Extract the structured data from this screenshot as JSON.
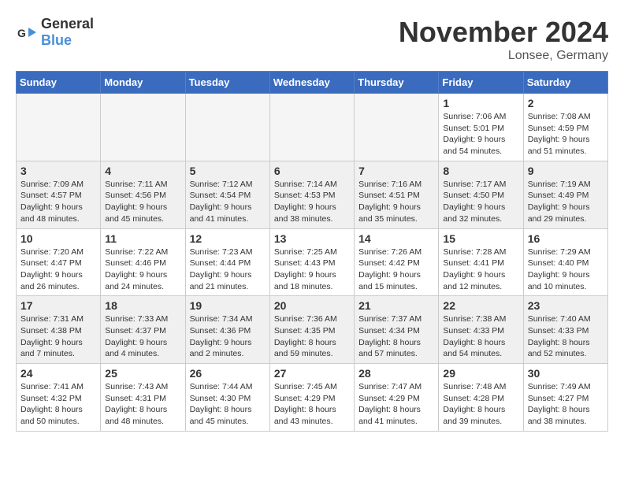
{
  "logo": {
    "text_general": "General",
    "text_blue": "Blue"
  },
  "header": {
    "month": "November 2024",
    "location": "Lonsee, Germany"
  },
  "weekdays": [
    "Sunday",
    "Monday",
    "Tuesday",
    "Wednesday",
    "Thursday",
    "Friday",
    "Saturday"
  ],
  "weeks": [
    [
      {
        "day": "",
        "empty": true
      },
      {
        "day": "",
        "empty": true
      },
      {
        "day": "",
        "empty": true
      },
      {
        "day": "",
        "empty": true
      },
      {
        "day": "",
        "empty": true
      },
      {
        "day": "1",
        "sunrise": "7:06 AM",
        "sunset": "5:01 PM",
        "daylight": "9 hours and 54 minutes."
      },
      {
        "day": "2",
        "sunrise": "7:08 AM",
        "sunset": "4:59 PM",
        "daylight": "9 hours and 51 minutes."
      }
    ],
    [
      {
        "day": "3",
        "sunrise": "7:09 AM",
        "sunset": "4:57 PM",
        "daylight": "9 hours and 48 minutes."
      },
      {
        "day": "4",
        "sunrise": "7:11 AM",
        "sunset": "4:56 PM",
        "daylight": "9 hours and 45 minutes."
      },
      {
        "day": "5",
        "sunrise": "7:12 AM",
        "sunset": "4:54 PM",
        "daylight": "9 hours and 41 minutes."
      },
      {
        "day": "6",
        "sunrise": "7:14 AM",
        "sunset": "4:53 PM",
        "daylight": "9 hours and 38 minutes."
      },
      {
        "day": "7",
        "sunrise": "7:16 AM",
        "sunset": "4:51 PM",
        "daylight": "9 hours and 35 minutes."
      },
      {
        "day": "8",
        "sunrise": "7:17 AM",
        "sunset": "4:50 PM",
        "daylight": "9 hours and 32 minutes."
      },
      {
        "day": "9",
        "sunrise": "7:19 AM",
        "sunset": "4:49 PM",
        "daylight": "9 hours and 29 minutes."
      }
    ],
    [
      {
        "day": "10",
        "sunrise": "7:20 AM",
        "sunset": "4:47 PM",
        "daylight": "9 hours and 26 minutes."
      },
      {
        "day": "11",
        "sunrise": "7:22 AM",
        "sunset": "4:46 PM",
        "daylight": "9 hours and 24 minutes."
      },
      {
        "day": "12",
        "sunrise": "7:23 AM",
        "sunset": "4:44 PM",
        "daylight": "9 hours and 21 minutes."
      },
      {
        "day": "13",
        "sunrise": "7:25 AM",
        "sunset": "4:43 PM",
        "daylight": "9 hours and 18 minutes."
      },
      {
        "day": "14",
        "sunrise": "7:26 AM",
        "sunset": "4:42 PM",
        "daylight": "9 hours and 15 minutes."
      },
      {
        "day": "15",
        "sunrise": "7:28 AM",
        "sunset": "4:41 PM",
        "daylight": "9 hours and 12 minutes."
      },
      {
        "day": "16",
        "sunrise": "7:29 AM",
        "sunset": "4:40 PM",
        "daylight": "9 hours and 10 minutes."
      }
    ],
    [
      {
        "day": "17",
        "sunrise": "7:31 AM",
        "sunset": "4:38 PM",
        "daylight": "9 hours and 7 minutes."
      },
      {
        "day": "18",
        "sunrise": "7:33 AM",
        "sunset": "4:37 PM",
        "daylight": "9 hours and 4 minutes."
      },
      {
        "day": "19",
        "sunrise": "7:34 AM",
        "sunset": "4:36 PM",
        "daylight": "9 hours and 2 minutes."
      },
      {
        "day": "20",
        "sunrise": "7:36 AM",
        "sunset": "4:35 PM",
        "daylight": "8 hours and 59 minutes."
      },
      {
        "day": "21",
        "sunrise": "7:37 AM",
        "sunset": "4:34 PM",
        "daylight": "8 hours and 57 minutes."
      },
      {
        "day": "22",
        "sunrise": "7:38 AM",
        "sunset": "4:33 PM",
        "daylight": "8 hours and 54 minutes."
      },
      {
        "day": "23",
        "sunrise": "7:40 AM",
        "sunset": "4:33 PM",
        "daylight": "8 hours and 52 minutes."
      }
    ],
    [
      {
        "day": "24",
        "sunrise": "7:41 AM",
        "sunset": "4:32 PM",
        "daylight": "8 hours and 50 minutes."
      },
      {
        "day": "25",
        "sunrise": "7:43 AM",
        "sunset": "4:31 PM",
        "daylight": "8 hours and 48 minutes."
      },
      {
        "day": "26",
        "sunrise": "7:44 AM",
        "sunset": "4:30 PM",
        "daylight": "8 hours and 45 minutes."
      },
      {
        "day": "27",
        "sunrise": "7:45 AM",
        "sunset": "4:29 PM",
        "daylight": "8 hours and 43 minutes."
      },
      {
        "day": "28",
        "sunrise": "7:47 AM",
        "sunset": "4:29 PM",
        "daylight": "8 hours and 41 minutes."
      },
      {
        "day": "29",
        "sunrise": "7:48 AM",
        "sunset": "4:28 PM",
        "daylight": "8 hours and 39 minutes."
      },
      {
        "day": "30",
        "sunrise": "7:49 AM",
        "sunset": "4:27 PM",
        "daylight": "8 hours and 38 minutes."
      }
    ]
  ]
}
